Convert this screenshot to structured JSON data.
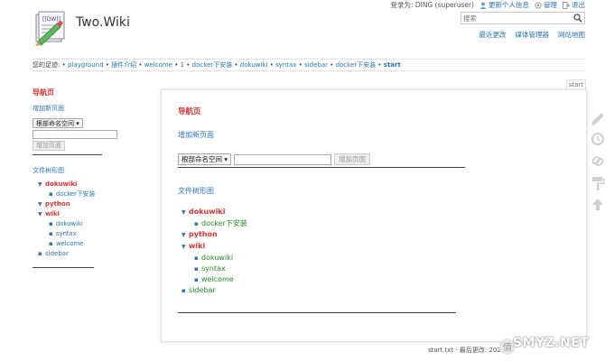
{
  "header": {
    "site_title": "Two.Wiki",
    "user_tools": [
      {
        "label": "登录为: DING (superuser)",
        "icon": ""
      },
      {
        "label": "更新个人信息",
        "icon": "user-icon"
      },
      {
        "label": "管理",
        "icon": "gear-icon"
      },
      {
        "label": "退出",
        "icon": "logout-icon"
      }
    ],
    "search_placeholder": "搜索",
    "site_tools": [
      "最近更改",
      "媒体管理器",
      "网站地图"
    ]
  },
  "breadcrumb": {
    "prefix": "您的足迹:",
    "items": [
      "playground",
      "插件介绍",
      "welcome",
      "1",
      "docker下安装",
      "dokuwiki",
      "syntax",
      "sidebar",
      "docker下安装",
      "start"
    ]
  },
  "sidebar": {
    "title": "导航页",
    "new_page": "增加新页面",
    "namespace_select": "根部命名空间",
    "add_button": "增加页面",
    "tree_title": "文件树形图",
    "tree": [
      {
        "label": "dokuwiki",
        "type": "ns",
        "children": [
          "docker下安装"
        ]
      },
      {
        "label": "python",
        "type": "ns",
        "children": []
      },
      {
        "label": "wiki",
        "type": "ns",
        "children": [
          "dokuwiki",
          "syntax",
          "welcome"
        ]
      },
      {
        "label": "sidebar",
        "type": "page",
        "children": []
      }
    ]
  },
  "main": {
    "tab_label": "start",
    "title": "导航页",
    "new_page": "增加新页面",
    "namespace_select": "根部命名空间",
    "add_button": "增加页面",
    "tree_title": "文件树形图",
    "tree": [
      {
        "label": "dokuwiki",
        "type": "ns",
        "children": [
          "docker下安装"
        ]
      },
      {
        "label": "python",
        "type": "ns",
        "children": []
      },
      {
        "label": "wiki",
        "type": "ns",
        "children": [
          "dokuwiki",
          "syntax",
          "welcome"
        ]
      },
      {
        "label": "sidebar",
        "type": "page",
        "children": []
      }
    ]
  },
  "page_tools": [
    "edit-icon",
    "revisions-icon",
    "backlinks-icon",
    "paint-roller-icon",
    "back-to-top-icon"
  ],
  "footer": {
    "docinfo": "start.txt · 最后更改: 2020"
  },
  "watermark": {
    "text": "SMYZ.NET"
  },
  "colors": {
    "link": "#2b73b7",
    "namespace": "#dd3333",
    "page_link": "#2b73b7",
    "content_page_link": "#228b22"
  }
}
